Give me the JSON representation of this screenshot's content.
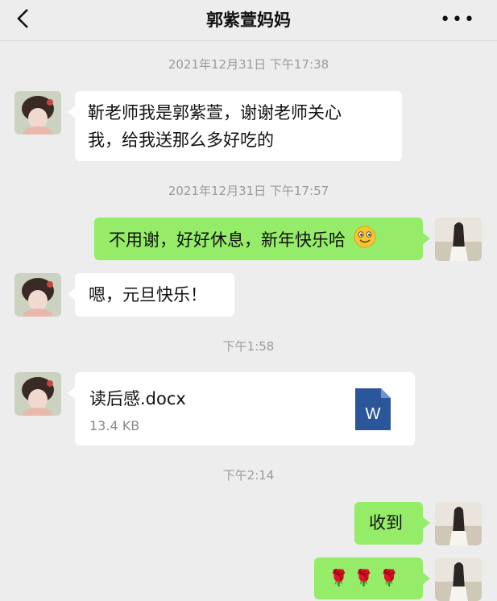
{
  "header": {
    "title": "郭紫萱妈妈"
  },
  "messages": {
    "t1": "2021年12月31日 下午17:38",
    "m1_line1": "靳老师我是郭紫萱，谢谢老师关心",
    "m1_line2": "我，给我送那么多好吃的",
    "t2": "2021年12月31日 下午17:57",
    "m2": "不用谢，好好休息，新年快乐哈",
    "m2_emoji": "smiley-icon",
    "m3": "嗯，元旦快乐！",
    "t3": "下午1:58",
    "file": {
      "name": "读后感.docx",
      "size": "13.4 KB",
      "icon": "word-doc-icon",
      "icon_letter": "W",
      "icon_color": "#2b579a"
    },
    "t4": "下午2:14",
    "m4": "收到",
    "m5": "🌹 🌹 🌹"
  },
  "colors": {
    "bg": "#ededed",
    "outgoing": "#95ec69",
    "incoming": "#ffffff"
  }
}
